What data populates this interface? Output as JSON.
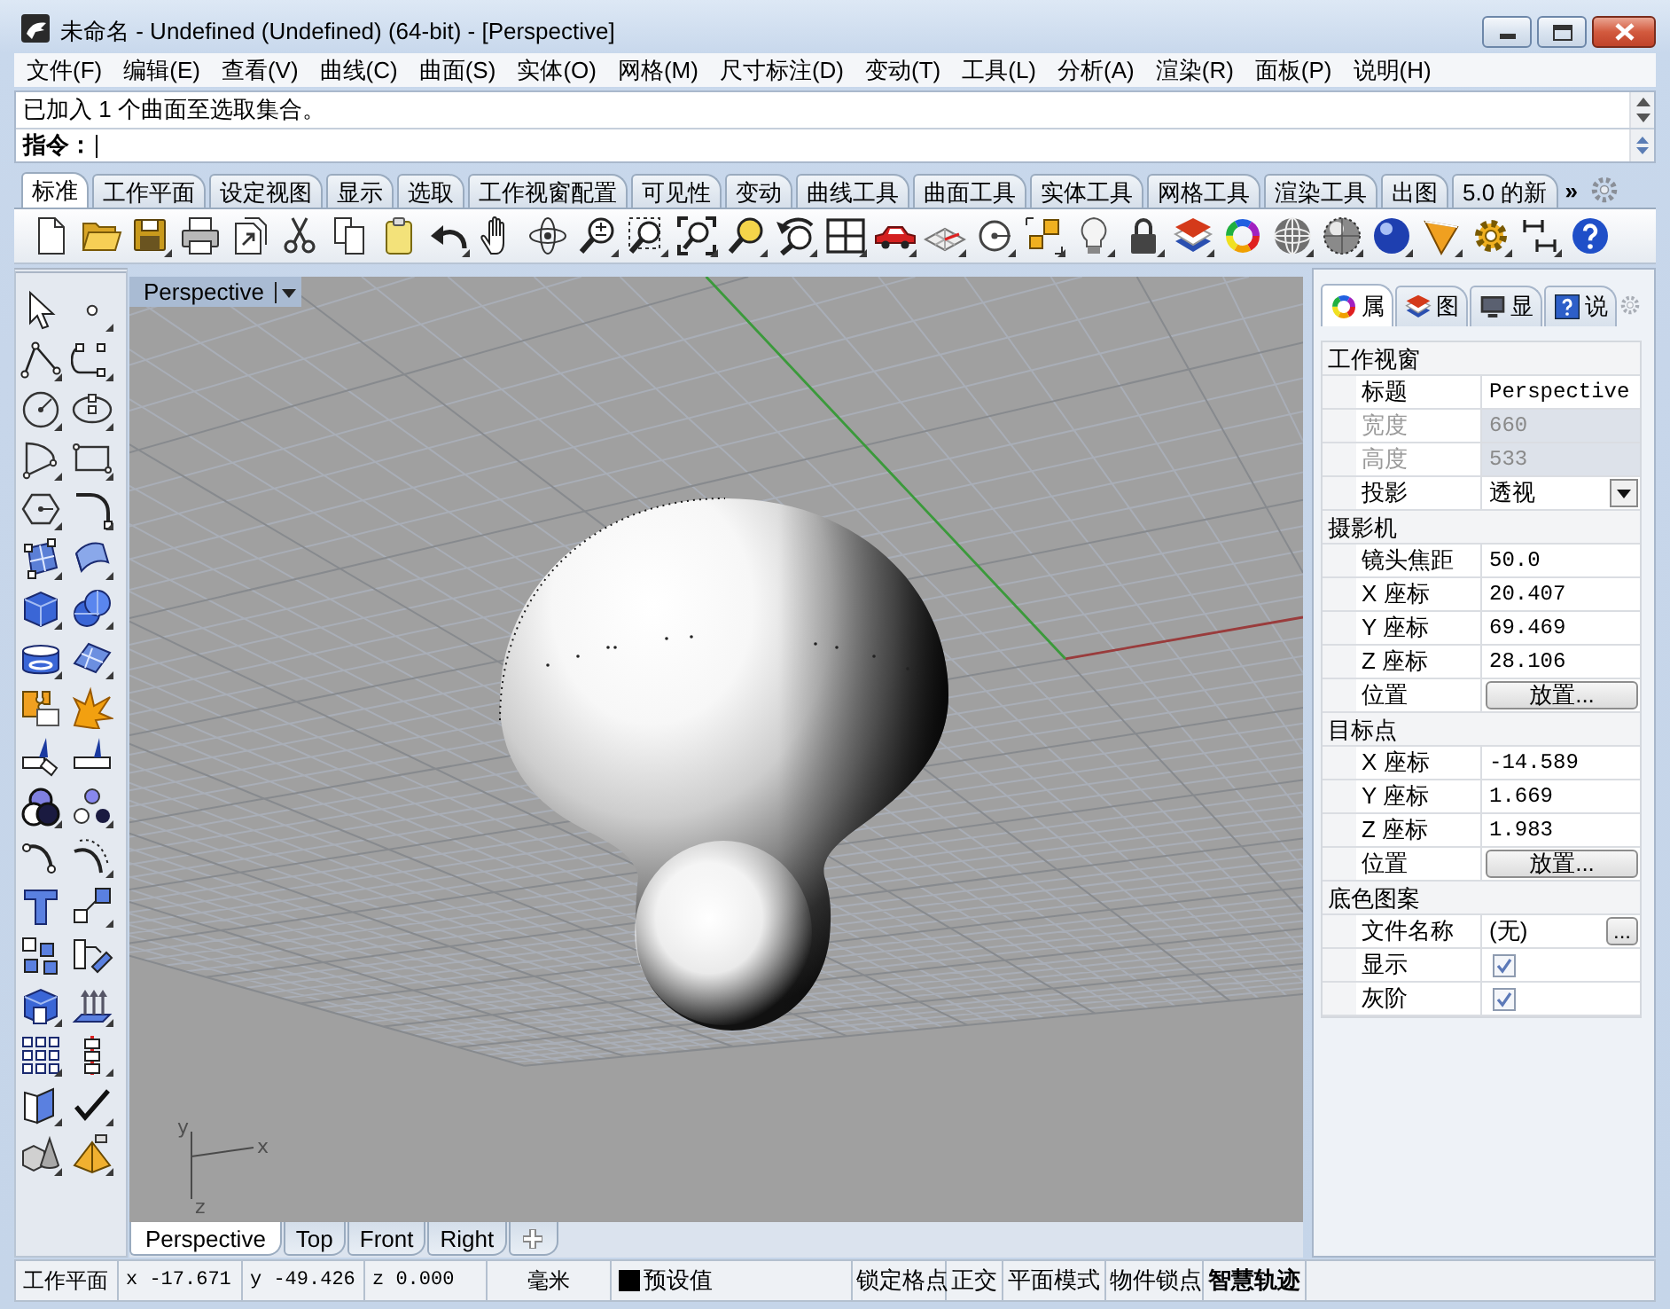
{
  "window": {
    "title": "未命名 - Undefined (Undefined) (64-bit) - [Perspective]"
  },
  "menu": [
    "文件(F)",
    "编辑(E)",
    "查看(V)",
    "曲线(C)",
    "曲面(S)",
    "实体(O)",
    "网格(M)",
    "尺寸标注(D)",
    "变动(T)",
    "工具(L)",
    "分析(A)",
    "渲染(R)",
    "面板(P)",
    "说明(H)"
  ],
  "command": {
    "history": "已加入 1 个曲面至选取集合。",
    "prompt": "指令："
  },
  "toolbar_tabs": {
    "tabs": [
      {
        "label": "标准",
        "selected": true
      },
      {
        "label": "工作平面",
        "selected": false
      },
      {
        "label": "设定视图",
        "selected": false
      },
      {
        "label": "显示",
        "selected": false
      },
      {
        "label": "选取",
        "selected": false
      },
      {
        "label": "工作视窗配置",
        "selected": false
      },
      {
        "label": "可见性",
        "selected": false
      },
      {
        "label": "变动",
        "selected": false
      },
      {
        "label": "曲线工具",
        "selected": false
      },
      {
        "label": "曲面工具",
        "selected": false
      },
      {
        "label": "实体工具",
        "selected": false
      },
      {
        "label": "网格工具",
        "selected": false
      },
      {
        "label": "渲染工具",
        "selected": false
      },
      {
        "label": "出图",
        "selected": false
      },
      {
        "label": "5.0 的新",
        "selected": false
      }
    ],
    "overflow": "»"
  },
  "toolbar": {
    "buttons": [
      {
        "flyout": false
      },
      {
        "flyout": false
      },
      {
        "flyout": true
      },
      {
        "flyout": false
      },
      {
        "flyout": false
      },
      {
        "flyout": false
      },
      {
        "flyout": false
      },
      {
        "flyout": false
      },
      {
        "flyout": true
      },
      {
        "flyout": false
      },
      {
        "flyout": false
      },
      {
        "flyout": true
      },
      {
        "flyout": true
      },
      {
        "flyout": true
      },
      {
        "flyout": true
      },
      {
        "flyout": true
      },
      {
        "flyout": true
      },
      {
        "flyout": true
      },
      {
        "flyout": true
      },
      {
        "flyout": true
      },
      {
        "flyout": true
      },
      {
        "flyout": true
      },
      {
        "flyout": true
      },
      {
        "flyout": true
      },
      {
        "flyout": false
      },
      {
        "flyout": true
      },
      {
        "flyout": true
      },
      {
        "flyout": true
      },
      {
        "flyout": true
      },
      {
        "flyout": true
      },
      {
        "flyout": true
      },
      {
        "flyout": false
      }
    ]
  },
  "side_toolbar": {
    "buttons": [
      {
        "flyout": false
      },
      {
        "flyout": true
      },
      {
        "flyout": true
      },
      {
        "flyout": true
      },
      {
        "flyout": true
      },
      {
        "flyout": true
      },
      {
        "flyout": true
      },
      {
        "flyout": true
      },
      {
        "flyout": true
      },
      {
        "flyout": true
      },
      {
        "flyout": true
      },
      {
        "flyout": true
      },
      {
        "flyout": true
      },
      {
        "flyout": true
      },
      {
        "flyout": true
      },
      {
        "flyout": true
      },
      {
        "flyout": false
      },
      {
        "flyout": false
      },
      {
        "flyout": false
      },
      {
        "flyout": false
      },
      {
        "flyout": true
      },
      {
        "flyout": true
      },
      {
        "flyout": false
      },
      {
        "flyout": true
      },
      {
        "flyout": false
      },
      {
        "flyout": true
      },
      {
        "flyout": false
      },
      {
        "flyout": false
      },
      {
        "flyout": true
      },
      {
        "flyout": true
      },
      {
        "flyout": true
      },
      {
        "flyout": true
      },
      {
        "flyout": true
      },
      {
        "flyout": true
      },
      {
        "flyout": true
      },
      {
        "flyout": true
      }
    ]
  },
  "viewport": {
    "title": "Perspective",
    "axis_labels": [
      "y",
      "x",
      "z"
    ],
    "tabs": [
      {
        "label": "Perspective",
        "selected": true
      },
      {
        "label": "Top",
        "selected": false
      },
      {
        "label": "Front",
        "selected": false
      },
      {
        "label": "Right",
        "selected": false
      }
    ]
  },
  "properties": {
    "tabs": [
      {
        "label": "属",
        "selected": true
      },
      {
        "label": "图",
        "selected": false
      },
      {
        "label": "显",
        "selected": false
      },
      {
        "label": "说",
        "selected": false
      }
    ],
    "sections": [
      {
        "title": "工作视窗",
        "rows": [
          {
            "label": "标题",
            "kind": "text",
            "value": "Perspective",
            "disabled": false
          },
          {
            "label": "宽度",
            "kind": "text",
            "value": "660",
            "disabled": true
          },
          {
            "label": "高度",
            "kind": "text",
            "value": "533",
            "disabled": true
          },
          {
            "label": "投影",
            "kind": "dropdown",
            "value": "透视",
            "disabled": false
          }
        ]
      },
      {
        "title": "摄影机",
        "rows": [
          {
            "label": "镜头焦距",
            "kind": "text",
            "value": "50.0",
            "disabled": false
          },
          {
            "label": "X 座标",
            "kind": "text",
            "value": "20.407",
            "disabled": false
          },
          {
            "label": "Y 座标",
            "kind": "text",
            "value": "69.469",
            "disabled": false
          },
          {
            "label": "Z 座标",
            "kind": "text",
            "value": "28.106",
            "disabled": false
          },
          {
            "label": "位置",
            "kind": "button",
            "value": "放置...",
            "disabled": false
          }
        ]
      },
      {
        "title": "目标点",
        "rows": [
          {
            "label": "X 座标",
            "kind": "text",
            "value": "-14.589",
            "disabled": false
          },
          {
            "label": "Y 座标",
            "kind": "text",
            "value": "1.669",
            "disabled": false
          },
          {
            "label": "Z 座标",
            "kind": "text",
            "value": "1.983",
            "disabled": false
          },
          {
            "label": "位置",
            "kind": "button",
            "value": "放置...",
            "disabled": false
          }
        ]
      },
      {
        "title": "底色图案",
        "rows": [
          {
            "label": "文件名称",
            "kind": "file",
            "value": "(无)",
            "button": "...",
            "disabled": false
          },
          {
            "label": "显示",
            "kind": "checkbox",
            "checked": true,
            "disabled": false
          },
          {
            "label": "灰阶",
            "kind": "checkbox",
            "checked": true,
            "disabled": false
          }
        ]
      }
    ]
  },
  "status_bar": {
    "cplane": "工作平面",
    "coords": [
      "x -17.671",
      "y -49.426",
      "z 0.000"
    ],
    "units": "毫米",
    "layer": "预设值",
    "toggles": [
      {
        "label": "锁定格点",
        "on": false
      },
      {
        "label": "正交",
        "on": false
      },
      {
        "label": "平面模式",
        "on": false
      },
      {
        "label": "物件锁点",
        "on": false
      },
      {
        "label": "智慧轨迹",
        "on": true
      }
    ]
  }
}
